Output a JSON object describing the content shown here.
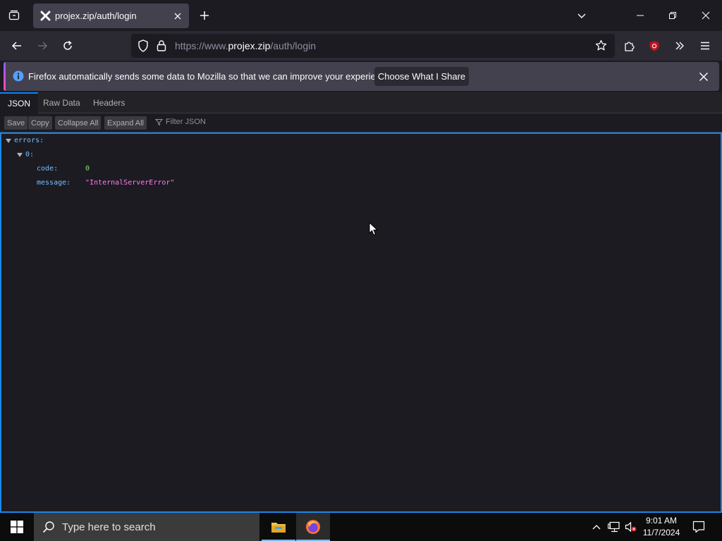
{
  "tab": {
    "title": "projex.zip/auth/login"
  },
  "urlbar": {
    "prefix": "https://www.",
    "domain": "projex.zip",
    "path": "/auth/login"
  },
  "notification": {
    "message": "Firefox automatically sends some data to Mozilla so that we can improve your experience.",
    "button": "Choose What I Share"
  },
  "viewer": {
    "tabs": [
      "JSON",
      "Raw Data",
      "Headers"
    ],
    "toolbar": {
      "save": "Save",
      "copy": "Copy",
      "collapse": "Collapse All",
      "expand": "Expand All",
      "filter_placeholder": "Filter JSON"
    }
  },
  "json": {
    "root_key": "errors:",
    "index_key": "0:",
    "code_key": "code:",
    "code_value": "0",
    "message_key": "message:",
    "message_value": "\"InternalServerError\""
  },
  "taskbar": {
    "search_placeholder": "Type here to search",
    "time": "9:01 AM",
    "date": "11/7/2024"
  },
  "colors": {
    "accent": "#0a84ff",
    "json_key": "#75bfff",
    "json_number": "#86de74",
    "json_string": "#ff7de9"
  }
}
